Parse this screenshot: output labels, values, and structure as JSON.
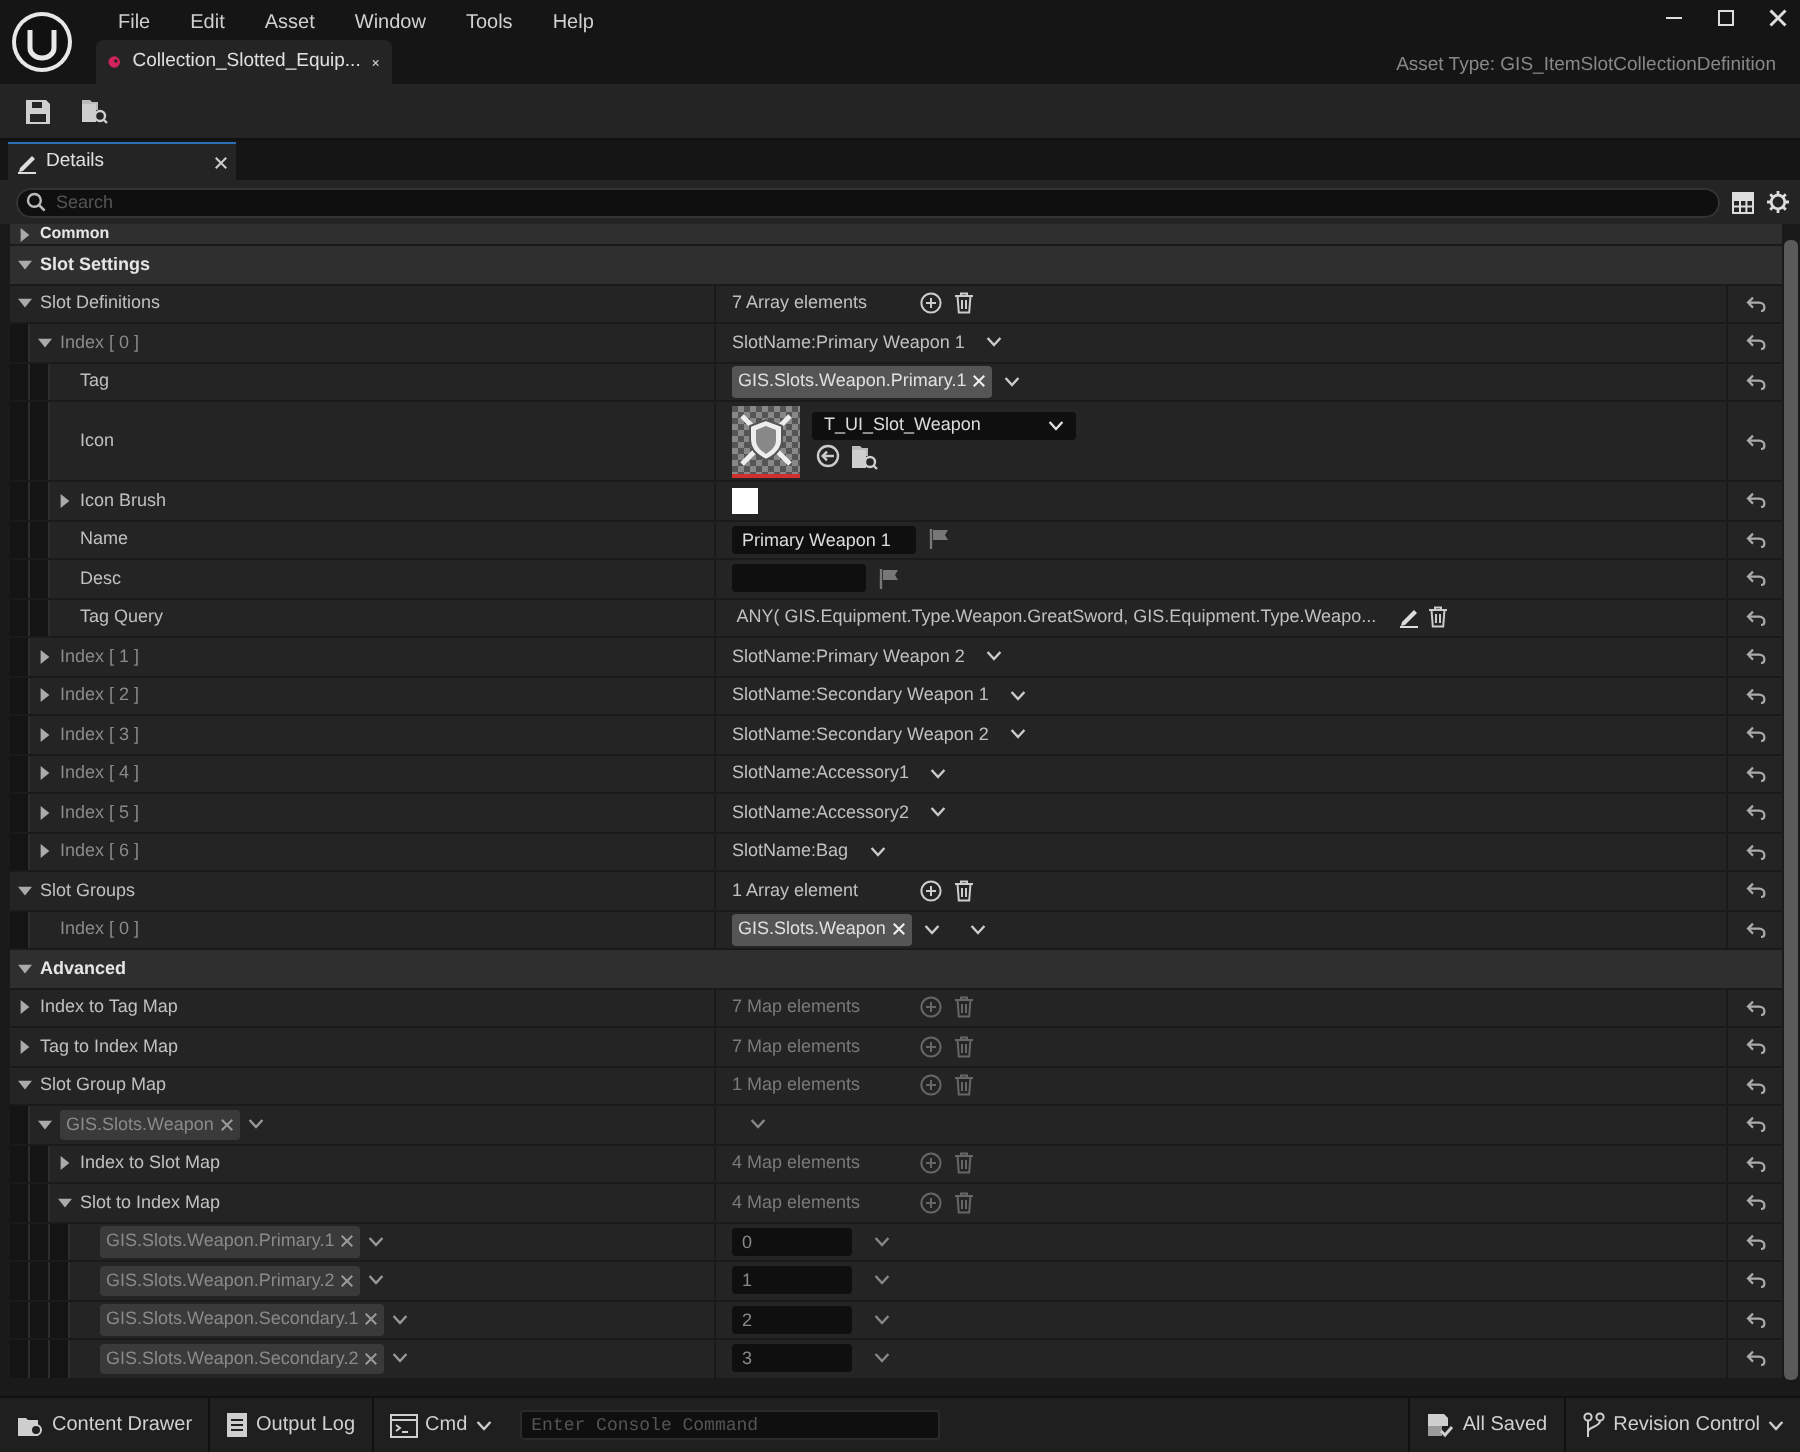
{
  "menu": [
    "File",
    "Edit",
    "Asset",
    "Window",
    "Tools",
    "Help"
  ],
  "document_tab": {
    "title": "Collection_Slotted_Equip..."
  },
  "asset_type": {
    "label": "Asset Type:",
    "value": "GIS_ItemSlotCollectionDefinition"
  },
  "panel_tab": {
    "title": "Details"
  },
  "search": {
    "placeholder": "Search"
  },
  "categories": [
    {
      "label": "Common",
      "expanded": false
    },
    {
      "label": "Slot Settings",
      "expanded": true,
      "properties": [
        {
          "label": "Slot Definitions",
          "kind": "name",
          "expanded": true,
          "value": {
            "kind": "count",
            "text": "7 Array elements",
            "disabled": false
          },
          "children": [
            {
              "label": "Index [ 0 ]",
              "kind": "index",
              "expanded": true,
              "value": {
                "kind": "combo",
                "text": "SlotName:Primary Weapon 1"
              },
              "children": [
                {
                  "label": "Tag",
                  "kind": "name",
                  "value": {
                    "kind": "tag",
                    "text": "GIS.Slots.Weapon.Primary.1",
                    "combo": false
                  }
                },
                {
                  "label": "Icon",
                  "kind": "name",
                  "value": {
                    "kind": "texture",
                    "text": "T_UI_Slot_Weapon"
                  }
                },
                {
                  "label": "Icon Brush",
                  "kind": "name",
                  "expanded": false,
                  "value": {
                    "kind": "color",
                    "color": "#ffffff"
                  }
                },
                {
                  "label": "Name",
                  "kind": "name",
                  "value": {
                    "kind": "text",
                    "text": "Primary Weapon 1"
                  }
                },
                {
                  "label": "Desc",
                  "kind": "name",
                  "value": {
                    "kind": "text"
                  }
                },
                {
                  "label": "Tag Query",
                  "kind": "name",
                  "value": {
                    "kind": "query",
                    "text": "ANY( GIS.Equipment.Type.Weapon.GreatSword, GIS.Equipment.Type.Weapo..."
                  }
                }
              ]
            },
            {
              "label": "Index [ 1 ]",
              "kind": "index",
              "expanded": false,
              "value": {
                "kind": "combo",
                "text": "SlotName:Primary Weapon 2"
              }
            },
            {
              "label": "Index [ 2 ]",
              "kind": "index",
              "expanded": false,
              "value": {
                "kind": "combo",
                "text": "SlotName:Secondary Weapon 1"
              }
            },
            {
              "label": "Index [ 3 ]",
              "kind": "index",
              "expanded": false,
              "value": {
                "kind": "combo",
                "text": "SlotName:Secondary Weapon 2"
              }
            },
            {
              "label": "Index [ 4 ]",
              "kind": "index",
              "expanded": false,
              "value": {
                "kind": "combo",
                "text": "SlotName:Accessory1"
              }
            },
            {
              "label": "Index [ 5 ]",
              "kind": "index",
              "expanded": false,
              "value": {
                "kind": "combo",
                "text": "SlotName:Accessory2"
              }
            },
            {
              "label": "Index [ 6 ]",
              "kind": "index",
              "expanded": false,
              "value": {
                "kind": "combo",
                "text": "SlotName:Bag"
              }
            }
          ]
        },
        {
          "label": "Slot Groups",
          "kind": "name",
          "expanded": true,
          "value": {
            "kind": "count",
            "text": "1 Array element",
            "disabled": false
          },
          "children": [
            {
              "label": "Index [ 0 ]",
              "kind": "index",
              "value": {
                "kind": "tag",
                "text": "GIS.Slots.Weapon",
                "combo": true
              }
            }
          ]
        }
      ]
    },
    {
      "label": "Advanced",
      "expanded": true,
      "properties": [
        {
          "label": "Index to Tag Map",
          "kind": "name",
          "expanded": false,
          "value": {
            "kind": "count",
            "text": "7 Map elements",
            "disabled": true
          }
        },
        {
          "label": "Tag to Index Map",
          "kind": "name",
          "expanded": false,
          "value": {
            "kind": "count",
            "text": "7 Map elements",
            "disabled": true
          }
        },
        {
          "label": "Slot Group Map",
          "kind": "name",
          "expanded": true,
          "value": {
            "kind": "count",
            "text": "1 Map elements",
            "disabled": true
          },
          "children": [
            {
              "label": "GIS.Slots.Weapon",
              "kind": "tag",
              "expanded": true,
              "value": {
                "kind": "caret"
              },
              "children": [
                {
                  "label": "Index to Slot Map",
                  "kind": "name",
                  "expanded": false,
                  "value": {
                    "kind": "count",
                    "text": "4 Map elements",
                    "disabled": true
                  }
                },
                {
                  "label": "Slot to Index Map",
                  "kind": "name",
                  "expanded": true,
                  "value": {
                    "kind": "count",
                    "text": "4 Map elements",
                    "disabled": true
                  },
                  "children": [
                    {
                      "label": "GIS.Slots.Weapon.Primary.1",
                      "kind": "tag",
                      "value": {
                        "kind": "number",
                        "text": "0"
                      }
                    },
                    {
                      "label": "GIS.Slots.Weapon.Primary.2",
                      "kind": "tag",
                      "value": {
                        "kind": "number",
                        "text": "1"
                      }
                    },
                    {
                      "label": "GIS.Slots.Weapon.Secondary.1",
                      "kind": "tag",
                      "value": {
                        "kind": "number",
                        "text": "2"
                      }
                    },
                    {
                      "label": "GIS.Slots.Weapon.Secondary.2",
                      "kind": "tag",
                      "value": {
                        "kind": "number",
                        "text": "3"
                      }
                    }
                  ]
                }
              ]
            }
          ]
        }
      ]
    }
  ],
  "status_bar": {
    "content_drawer": "Content Drawer",
    "output_log": "Output Log",
    "cmd": "Cmd",
    "console_placeholder": "Enter Console Command",
    "saved": "All Saved",
    "revision": "Revision Control"
  }
}
